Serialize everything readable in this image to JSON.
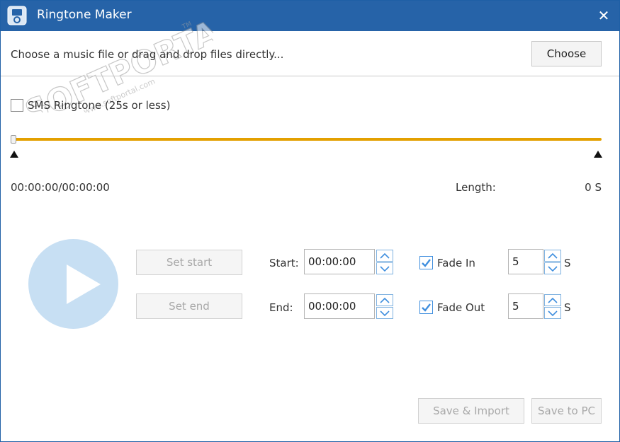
{
  "window": {
    "title": "Ringtone Maker",
    "close_glyph": "✕",
    "app_icon": "ringtone-app-icon",
    "title_bar_color": "#2663a8"
  },
  "watermark": {
    "brand": "SOFTPORTAL",
    "url": "www.softportal.com",
    "tm": "TM"
  },
  "file": {
    "hint": "Choose a music file or drag and drop files directly...",
    "choose_label": "Choose"
  },
  "sms": {
    "label": "SMS Ringtone (25s or less)",
    "checked": false
  },
  "timeline": {
    "track_color": "#e3a000",
    "time": "00:00:00/00:00:00",
    "length_label": "Length:",
    "length_value": "0 S"
  },
  "controls": {
    "set_start_label": "Set start",
    "set_end_label": "Set end",
    "start_label": "Start:",
    "start_value": "00:00:00",
    "end_label": "End:",
    "end_value": "00:00:00",
    "play_color": "#c7dff3"
  },
  "fade": {
    "fade_in_label": "Fade In",
    "fade_in_checked": true,
    "fade_in_value": "5",
    "fade_out_label": "Fade Out",
    "fade_out_checked": true,
    "fade_out_value": "5",
    "unit": "S",
    "check_color": "#3e8ede"
  },
  "actions": {
    "save_import_label": "Save & Import",
    "save_pc_label": "Save to PC"
  }
}
